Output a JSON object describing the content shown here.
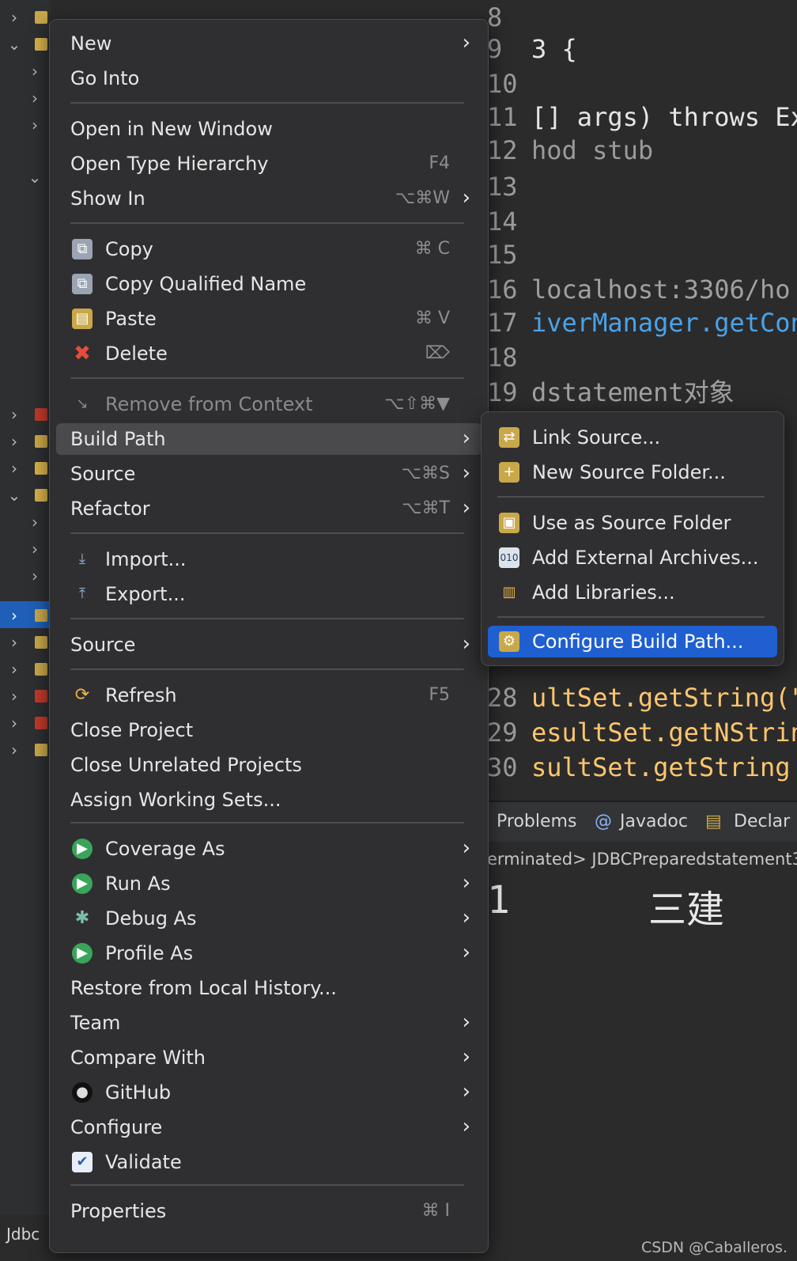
{
  "explorer": {
    "footer_label": "Jdbc"
  },
  "editor": {
    "lines": [
      {
        "num": "8",
        "code": ""
      },
      {
        "num": "9",
        "code": "3 {"
      },
      {
        "num": "10",
        "code": ""
      },
      {
        "num": "11",
        "code": "[] args) throws Ex"
      },
      {
        "num": "12",
        "code": "hod stub"
      },
      {
        "num": "13",
        "code": ""
      },
      {
        "num": "14",
        "code": ""
      },
      {
        "num": "15",
        "code": ""
      },
      {
        "num": "16",
        "code": "localhost:3306/ho"
      },
      {
        "num": "17",
        "code": "iverManager.getCon"
      },
      {
        "num": "18",
        "code": ""
      },
      {
        "num": "19",
        "code": "dstatement对象"
      },
      {
        "num": "28",
        "code": "ultSet.getString(\""
      },
      {
        "num": "29",
        "code": "esultSet.getNStrin"
      },
      {
        "num": "30",
        "code": "sultSet.getString"
      }
    ]
  },
  "bottom_panel": {
    "tabs": [
      "Problems",
      "Javadoc",
      "Declar"
    ],
    "console_status": "erminated> JDBCPreparedstatement3",
    "output_col1": "1",
    "output_col2": "三建"
  },
  "context_menu": {
    "new": "New",
    "go_into": "Go Into",
    "open_new_window": "Open in New Window",
    "open_type_hierarchy": "Open Type Hierarchy",
    "open_type_hierarchy_key": "F4",
    "show_in": "Show In",
    "show_in_key": "⌥⌘W",
    "copy": "Copy",
    "copy_key": "⌘ C",
    "copy_qualified": "Copy Qualified Name",
    "paste": "Paste",
    "paste_key": "⌘ V",
    "delete": "Delete",
    "delete_key": "⌦",
    "remove_context": "Remove from Context",
    "remove_context_key": "⌥⇧⌘▼",
    "build_path": "Build Path",
    "source": "Source",
    "source_key": "⌥⌘S",
    "refactor": "Refactor",
    "refactor_key": "⌥⌘T",
    "import": "Import...",
    "export": "Export...",
    "source2": "Source",
    "refresh": "Refresh",
    "refresh_key": "F5",
    "close_project": "Close Project",
    "close_unrelated": "Close Unrelated Projects",
    "assign_working_sets": "Assign Working Sets...",
    "coverage_as": "Coverage As",
    "run_as": "Run As",
    "debug_as": "Debug As",
    "profile_as": "Profile As",
    "restore_history": "Restore from Local History...",
    "team": "Team",
    "compare_with": "Compare With",
    "github": "GitHub",
    "configure": "Configure",
    "validate": "Validate",
    "properties": "Properties",
    "properties_key": "⌘ I"
  },
  "build_path_submenu": {
    "link_source": "Link Source...",
    "new_source_folder": "New Source Folder...",
    "use_as_source": "Use as Source Folder",
    "add_external_archives": "Add External Archives...",
    "add_libraries": "Add Libraries...",
    "configure_build_path": "Configure Build Path..."
  },
  "watermark": "CSDN @Caballeros.",
  "colors": {
    "menu_bg": "#2f2f31",
    "selection_blue": "#1f5fd0",
    "keyword": "#cc7832",
    "field": "#9876aa",
    "method": "#ffc66d"
  }
}
